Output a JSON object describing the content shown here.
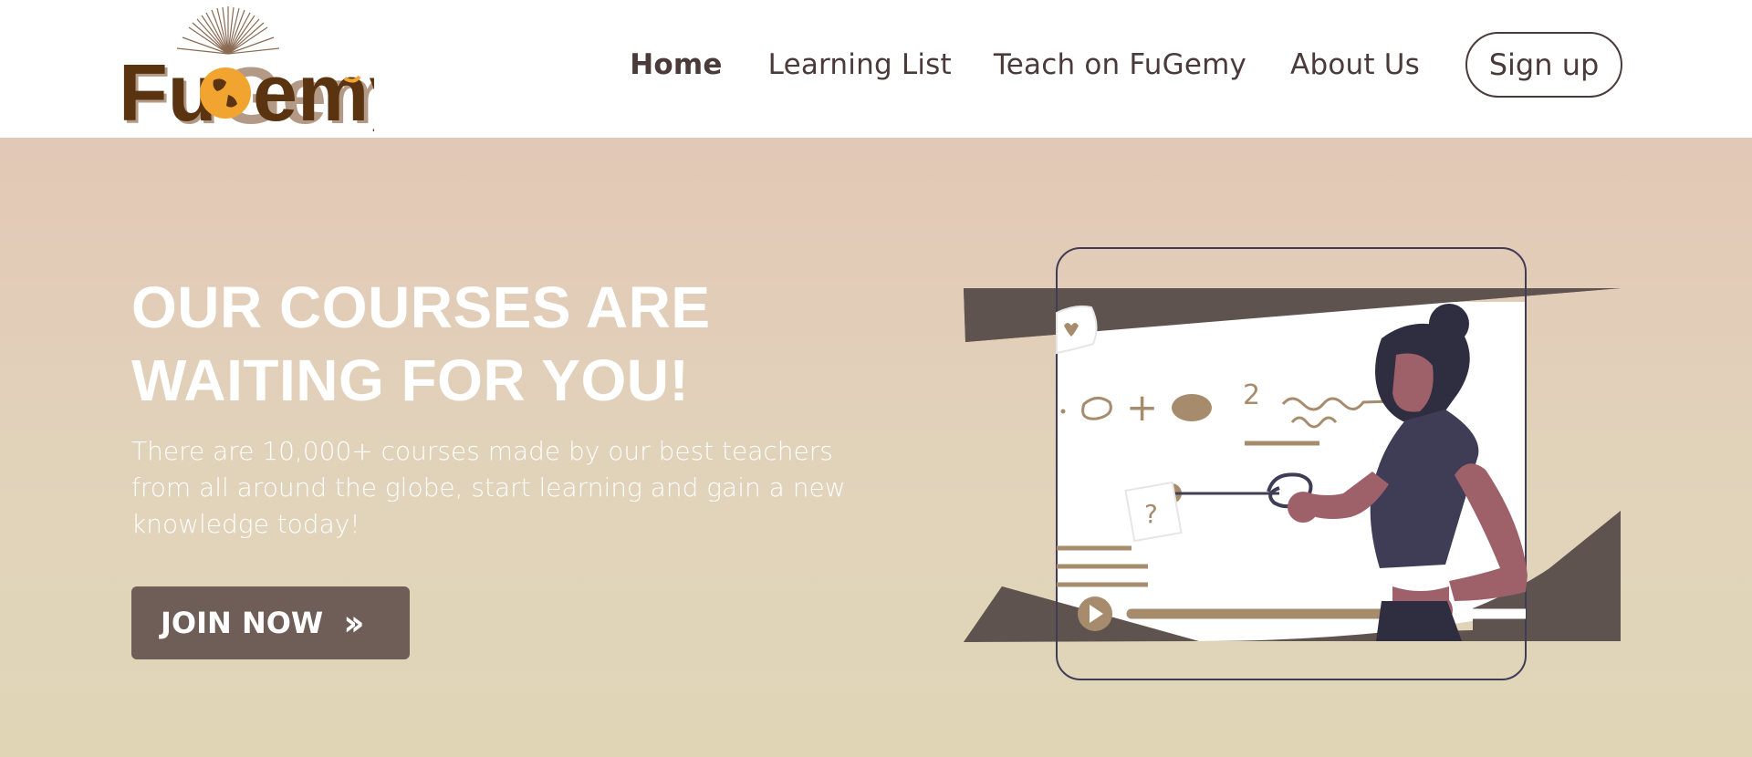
{
  "header": {
    "logo_text": "FuGemy",
    "nav": [
      {
        "label": "Home",
        "active": true
      },
      {
        "label": "Learning List",
        "active": false
      },
      {
        "label": "Teach on FuGemy",
        "active": false
      },
      {
        "label": "About Us",
        "active": false
      }
    ],
    "signup_label": "Sign up"
  },
  "hero": {
    "title_line1": "OUR COURSES ARE",
    "title_line2": "WAITING FOR YOU!",
    "subtitle": "There are 10,000+ courses made by our best teachers from all around the globe, start learning and gain a new knowledge today!",
    "join_label": "JOIN NOW",
    "join_icon": "double-chevron-right-icon"
  },
  "illustration": {
    "board_formula_left": "+",
    "board_char": "2",
    "note_char": "?"
  },
  "colors": {
    "brand_brown": "#5a3310",
    "brand_orange": "#f2a431",
    "hero_top": "#e2c8b6",
    "hero_bottom": "#e0d6b6",
    "button": "#6e5e57",
    "dark_slab": "#5f534f",
    "accent_tan": "#a68c6c",
    "skin": "#9e616a",
    "shirt": "#3f3d56",
    "hair": "#2f2e41",
    "text_dark": "#4a3a3a"
  }
}
